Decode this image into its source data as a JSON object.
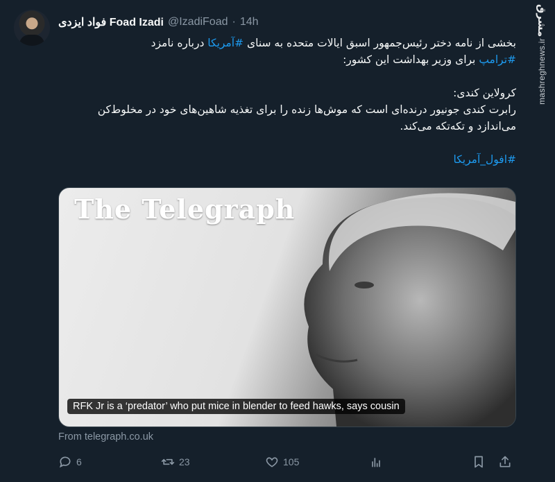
{
  "watermark": {
    "logo": "مشرق",
    "site": "mashreghnews.ir"
  },
  "author": {
    "name": "فواد ایزدی Foad Izadi",
    "handle": "@IzadiFoad",
    "separator": "·",
    "time": "14h"
  },
  "tweet": {
    "line1_pre": "بخشی از نامه دختر رئیس‌جمهور اسبق ایالات متحده به سنای ",
    "hashtag_america": "#آمریکا",
    "line1_post": " درباره نامزد",
    "hashtag_trump": "#ترامپ",
    "line2_post": " برای وزیر بهداشت این کشور:",
    "quote_label": "کرولاین کندی:",
    "quote_body": "رابرت کندی جونیور درنده‌ای است که موش‌ها زنده را برای تغذیه شاهین‌های خود در مخلوط‌کن می‌اندازد و تکه‌تکه می‌کند.",
    "hashtag_decline": "#افول_آمریکا"
  },
  "card": {
    "masthead": "The Telegraph",
    "headline": "RFK Jr is a ‘predator’ who put mice in blender to feed hawks, says cousin",
    "source": "From telegraph.co.uk"
  },
  "actions": {
    "replies": "6",
    "retweets": "23",
    "likes": "105"
  },
  "colors": {
    "background": "#15202b",
    "accent": "#1d9bf0",
    "muted": "#8b98a5"
  }
}
